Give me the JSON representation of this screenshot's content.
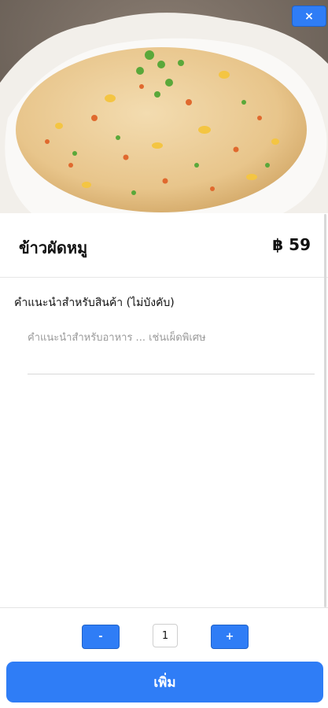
{
  "modal": {
    "close_label": "×",
    "hero_image_alt": "",
    "item_name": "ข้าวผัดหมู",
    "item_price": "฿ 59"
  },
  "note": {
    "label": "คำแนะนำสำหรับสินค้า (ไม่บังคับ)",
    "placeholder": "คำแนะนำสำหรับอาหาร ... เช่นเผ็ดพิเศษ",
    "value": ""
  },
  "quantity": {
    "minus_label": "-",
    "value": "1",
    "plus_label": "+"
  },
  "actions": {
    "add_label": "เพิ่ม"
  },
  "colors": {
    "accent": "#2f7df6",
    "divider": "#e6e6e6"
  }
}
